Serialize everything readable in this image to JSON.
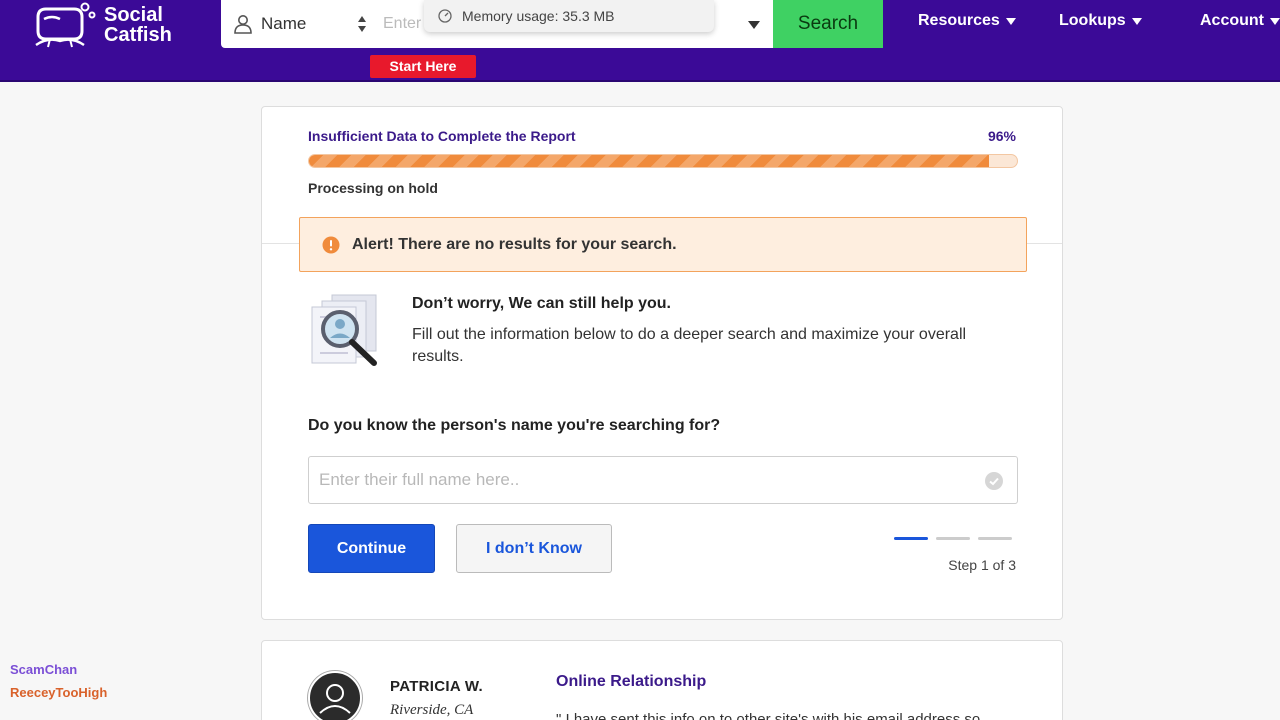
{
  "header": {
    "logo_line1": "Social",
    "logo_line2": "Catfish",
    "search_type_label": "Name",
    "search_placeholder": "Enter",
    "search_button": "Search",
    "start_here": "Start Here",
    "nav": [
      {
        "label": "Resources"
      },
      {
        "label": "Lookups"
      },
      {
        "label": "Account"
      }
    ]
  },
  "memory_tooltip": "Memory usage: 35.3 MB",
  "progress": {
    "title": "Insufficient Data to Complete the Report",
    "percent_label": "96%",
    "percent": 96,
    "status": "Processing on hold"
  },
  "alert": {
    "text": "Alert! There are no results for your search."
  },
  "help": {
    "title": "Don’t worry, We can still help you.",
    "body": "Fill out the information below to do a deeper search and maximize your overall results."
  },
  "form": {
    "question": "Do you know the person's name you're searching for?",
    "name_placeholder": "Enter their full name here..",
    "continue_label": "Continue",
    "dont_know_label": "I don’t Know",
    "step_label": "Step 1 of 3",
    "current_step": 1,
    "total_steps": 3
  },
  "testimonial": {
    "name": "PATRICIA W.",
    "location": "Riverside, CA",
    "heading": "Online Relationship",
    "quote": "\" I have sent this info on to other site's with his email address so"
  },
  "chat": [
    {
      "user": "ScamChan",
      "color": "#7b4fd6"
    },
    {
      "user": "ReeceyTooHigh",
      "color": "#d9622b"
    }
  ],
  "colors": {
    "header_bg": "#3b0a97",
    "search_button": "#3fd163",
    "start_here_bg": "#e8192c",
    "accent_blue": "#1a56db",
    "progress_orange": "#f08b3c",
    "alert_bg": "#feeedf"
  }
}
